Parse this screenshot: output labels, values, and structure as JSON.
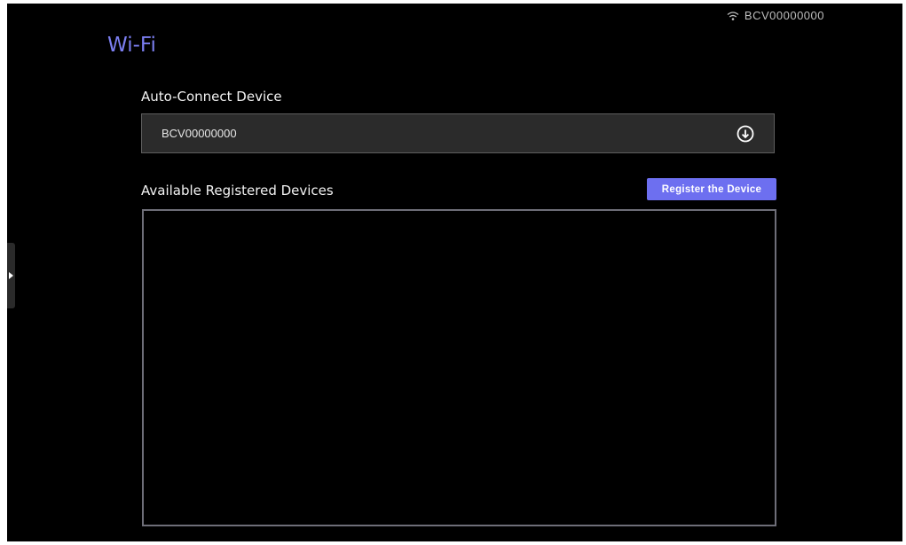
{
  "status_bar": {
    "network_name": "BCV00000000",
    "wifi_icon": "wifi-icon"
  },
  "page": {
    "title": "Wi-Fi"
  },
  "auto_connect": {
    "label": "Auto-Connect Device",
    "selected_value": "BCV00000000",
    "dropdown_icon": "arrow-down-circle-icon"
  },
  "registered": {
    "label": "Available Registered Devices",
    "register_button": "Register the Device",
    "devices": []
  },
  "side_panel": {
    "handle_icon": "caret-right-icon"
  },
  "colors": {
    "accent": "#6d6ff0",
    "title": "#7b7ef0",
    "background": "#000000"
  }
}
